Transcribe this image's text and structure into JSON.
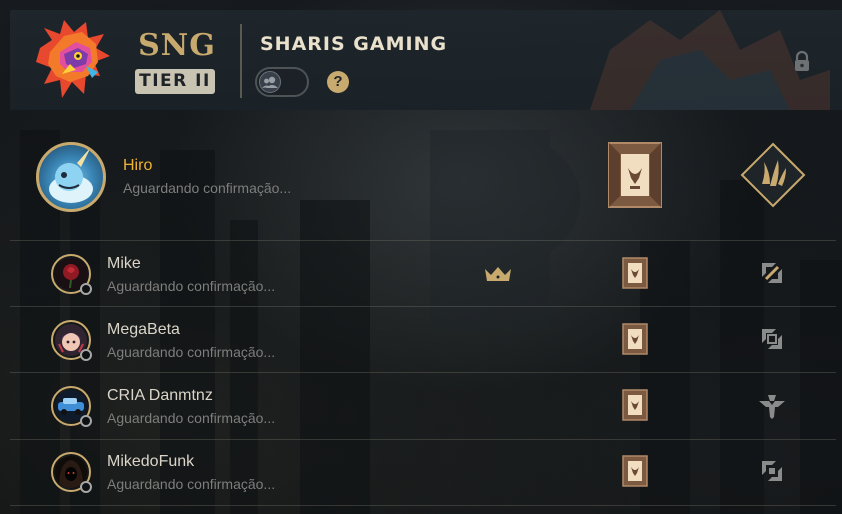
{
  "team": {
    "tag": "SNG",
    "tier": "TIER II",
    "name": "SHARIS GAMING",
    "logo_icon": "phoenix-logo-icon",
    "toggle_icon": "friends-toggle-icon",
    "help_label": "?",
    "lock_icon": "lock-icon"
  },
  "colors": {
    "gold": "#c8aa6e",
    "highlight_name": "#f0b232",
    "text": "#dad5c8",
    "status_text": "#7d7e7c"
  },
  "players": [
    {
      "name": "Hiro",
      "status": "Aguardando confirmação...",
      "is_self": true,
      "avatar_icon": "narwhal-avatar-icon",
      "captain": false,
      "role_icon": "jungle-role-icon",
      "card_icon": "banner-card-icon"
    },
    {
      "name": "Mike",
      "status": "Aguardando confirmação...",
      "is_self": false,
      "avatar_icon": "rose-avatar-icon",
      "captain": true,
      "captain_icon": "crown-icon",
      "role_icon": "top-role-icon",
      "card_icon": "banner-card-icon"
    },
    {
      "name": "MegaBeta",
      "status": "Aguardando confirmação...",
      "is_self": false,
      "avatar_icon": "girl-avatar-icon",
      "captain": false,
      "role_icon": "mid-role-icon",
      "card_icon": "banner-card-icon"
    },
    {
      "name": "CRIA Danmtnz",
      "status": "Aguardando confirmação...",
      "is_self": false,
      "avatar_icon": "car-avatar-icon",
      "captain": false,
      "role_icon": "support-role-icon",
      "card_icon": "banner-card-icon"
    },
    {
      "name": "MikedoFunk",
      "status": "Aguardando confirmação...",
      "is_self": false,
      "avatar_icon": "hooded-avatar-icon",
      "captain": false,
      "role_icon": "bottom-role-icon",
      "card_icon": "banner-card-icon"
    }
  ]
}
